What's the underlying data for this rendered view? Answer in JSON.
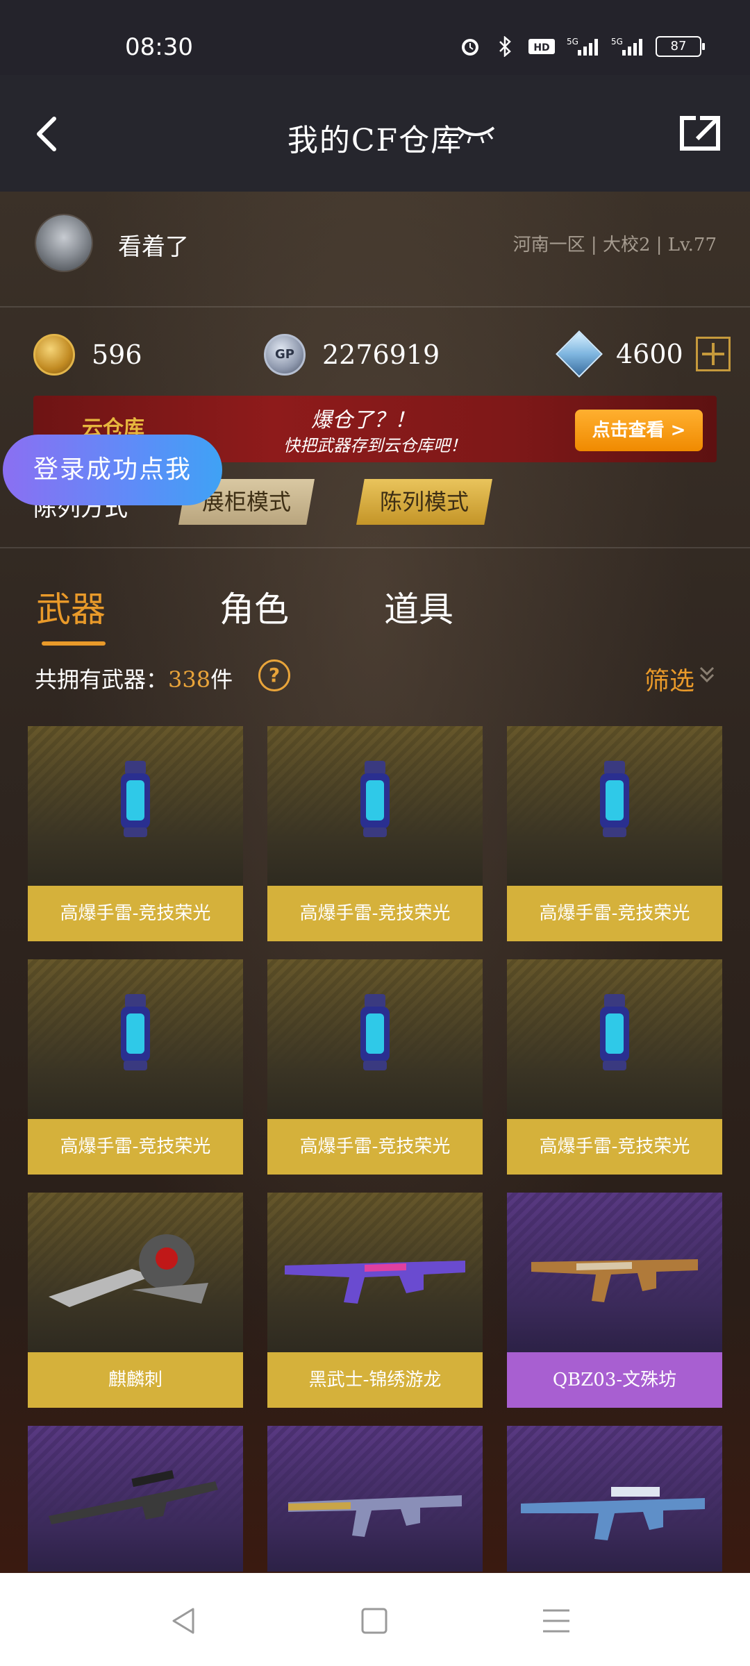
{
  "status_bar": {
    "time": "08:30",
    "battery": "87",
    "network": [
      "5G",
      "5G"
    ],
    "hd": "HD2"
  },
  "header": {
    "title": "我的CF仓库"
  },
  "profile": {
    "username": "看着了",
    "server_info": "河南一区 | 大校2 | Lv.77"
  },
  "currency": {
    "cf_points": "596",
    "gp": "2276919",
    "gp_icon_text": "GP",
    "diamonds": "4600"
  },
  "banner": {
    "logo_text": "云仓库",
    "line1": "爆仓了？！",
    "line2": "快把武器存到云仓库吧！",
    "button": "点击查看 >"
  },
  "display_mode": {
    "label": "陈列方式",
    "showcase": "展柜模式",
    "list": "陈列模式"
  },
  "toast": "登录成功点我",
  "tabs": {
    "weapon": "武器",
    "role": "角色",
    "item": "道具"
  },
  "count": {
    "prefix": "共拥有武器：",
    "number": "338",
    "suffix": "件",
    "help": "?"
  },
  "filter": "筛选",
  "weapons": [
    {
      "name": "高爆手雷-竞技荣光",
      "rarity": "gold"
    },
    {
      "name": "高爆手雷-竞技荣光",
      "rarity": "gold"
    },
    {
      "name": "高爆手雷-竞技荣光",
      "rarity": "gold"
    },
    {
      "name": "高爆手雷-竞技荣光",
      "rarity": "gold"
    },
    {
      "name": "高爆手雷-竞技荣光",
      "rarity": "gold"
    },
    {
      "name": "高爆手雷-竞技荣光",
      "rarity": "gold"
    },
    {
      "name": "麒麟刺",
      "rarity": "gold"
    },
    {
      "name": "黑武士-锦绣游龙",
      "rarity": "gold"
    },
    {
      "name": "QBZ03-文殊坊",
      "rarity": "purple"
    },
    {
      "name": "",
      "rarity": "purple"
    },
    {
      "name": "",
      "rarity": "purple"
    },
    {
      "name": "",
      "rarity": "purple"
    }
  ],
  "colors": {
    "accent": "#e99a2a",
    "gold_label": "#d5b13b",
    "purple_label": "#a85fd1"
  }
}
